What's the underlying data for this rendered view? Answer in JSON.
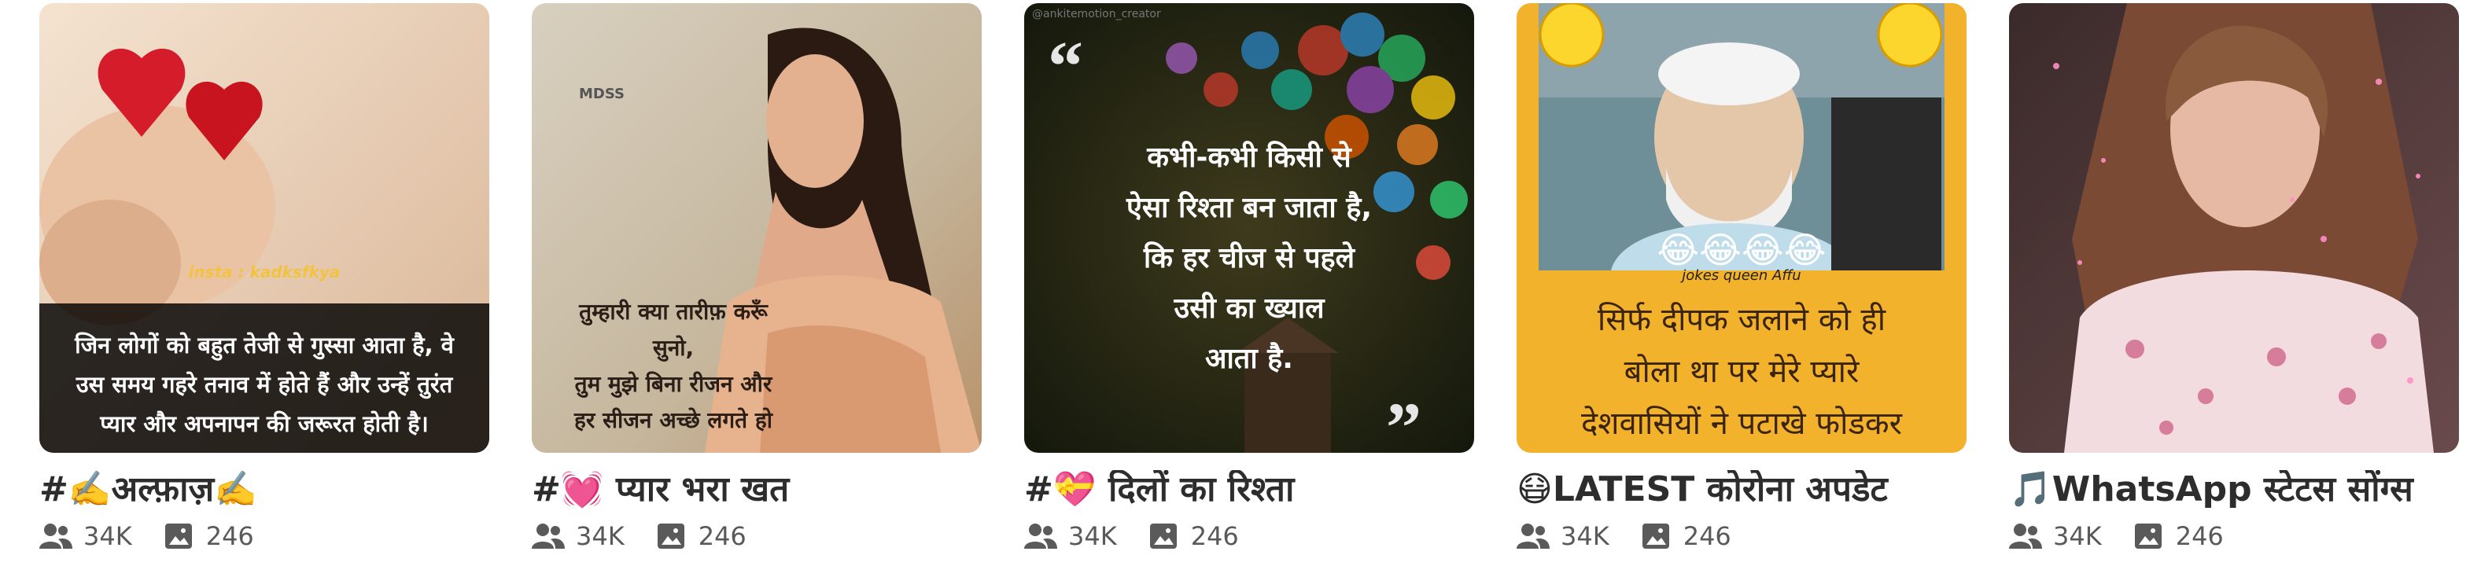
{
  "cards": [
    {
      "title": "#✍️अल्फ़ाज़✍️",
      "members": "34K",
      "posts": "246",
      "thumb": {
        "watermark": "insta : kadksfkya",
        "lines": [
          "जिन लोगों को बहुत तेजी से गुस्सा आता है, वे",
          "उस समय गहरे तनाव में होते हैं और उन्हें तुरंत",
          "प्यार और अपनापन की जरूरत होती है।"
        ]
      }
    },
    {
      "title": "#💓 प्यार भरा खत",
      "members": "34K",
      "posts": "246",
      "thumb": {
        "logo": "MDSS",
        "lines": [
          "तुम्हारी क्या तारीफ़ करूँ",
          "सुनो,",
          "तुम मुझे बिना रीजन और",
          "हर सीजन अच्छे लगते हो"
        ]
      }
    },
    {
      "title": "#💝 दिलों का रिश्ता",
      "members": "34K",
      "posts": "246",
      "thumb": {
        "handle": "@ankitemotion_creator",
        "lines": [
          "कभी-कभी किसी से",
          "ऐसा रिश्ता बन जाता है,",
          "कि हर चीज से पहले",
          "उसी का ख्याल",
          "आता है."
        ]
      }
    },
    {
      "title": "😷LATEST कोरोना अपडेट",
      "members": "34K",
      "posts": "246",
      "thumb": {
        "emojis": "😂😂😂😂",
        "credit": "jokes queen Affu",
        "lines": [
          "सिर्फ दीपक जलाने को ही",
          "बोला था पर मेरे प्यारे",
          "देशवासियों ने पटाखे फोडकर"
        ]
      }
    },
    {
      "title": "🎵WhatsApp स्टेटस सोंग्स",
      "members": "34K",
      "posts": "246",
      "thumb": {}
    }
  ]
}
